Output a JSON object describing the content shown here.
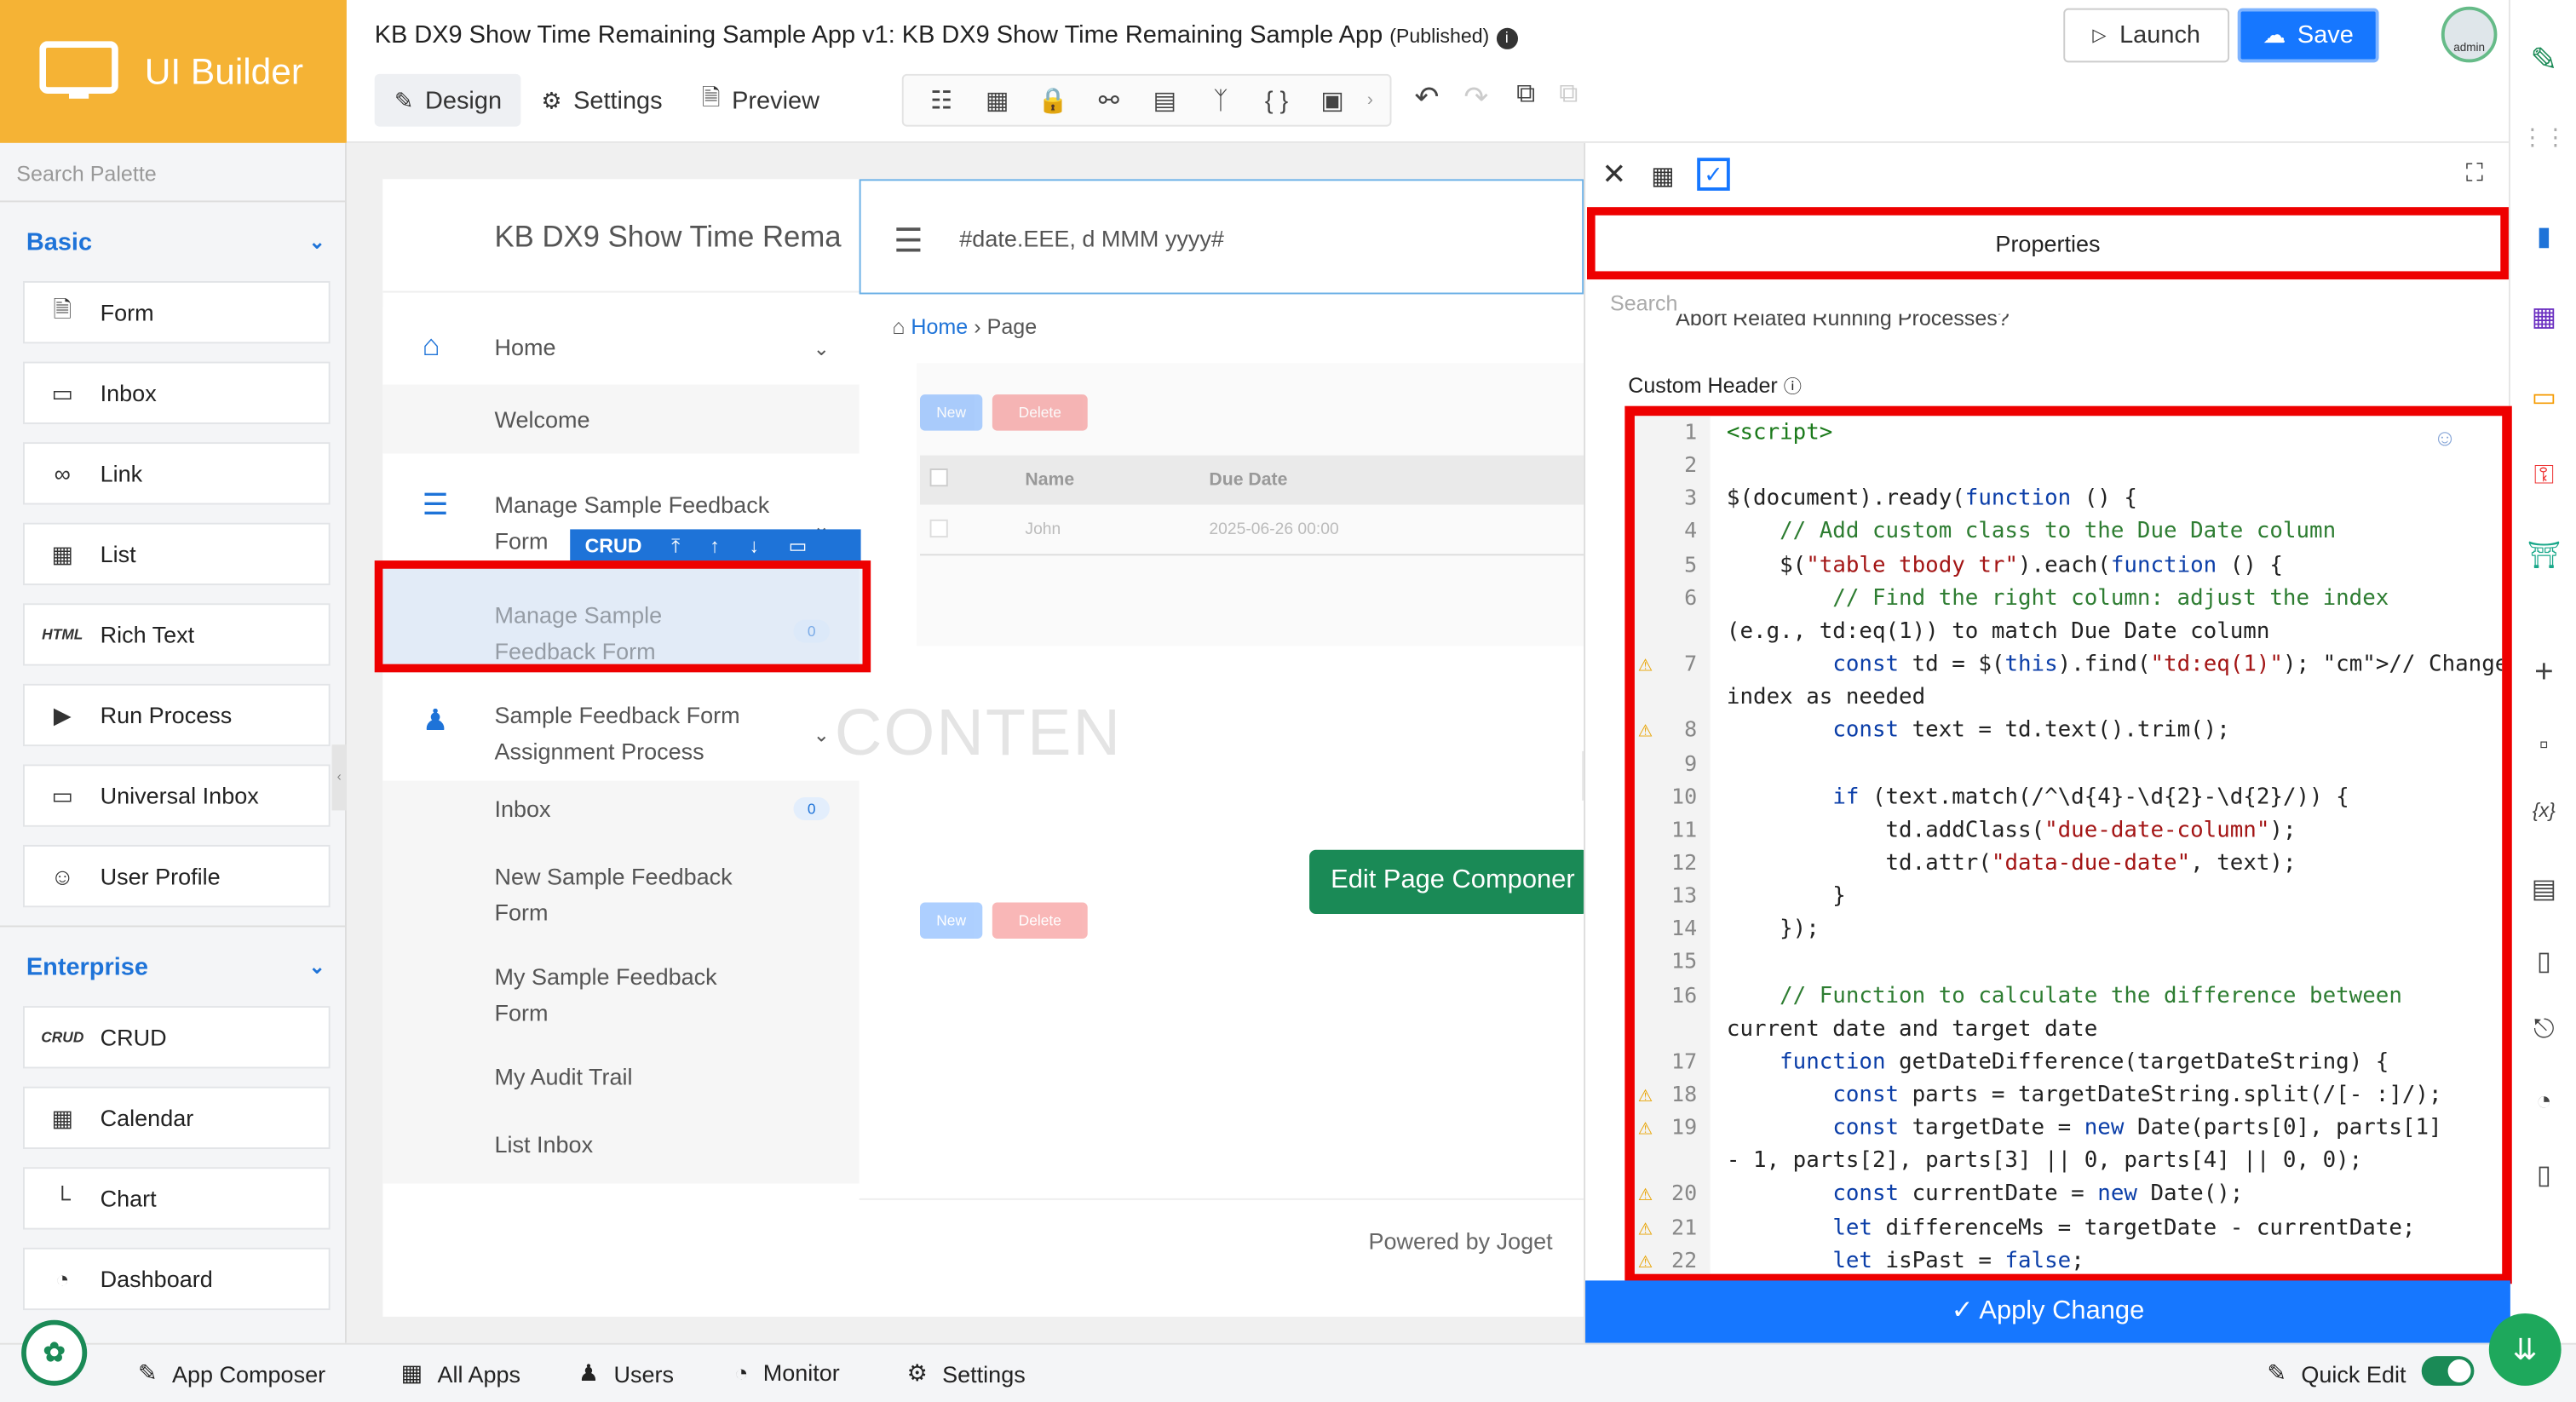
{
  "app": {
    "logo_text": "UI Builder",
    "title": "KB DX9 Show Time Remaining Sample App v1: KB DX9 Show Time Remaining Sample App",
    "status": "(Published)"
  },
  "tabs": [
    {
      "label": "Design"
    },
    {
      "label": "Settings"
    },
    {
      "label": "Preview"
    }
  ],
  "actions": {
    "launch": "Launch",
    "save": "Save",
    "avatar": "admin"
  },
  "palette": {
    "search_placeholder": "Search Palette",
    "basic_label": "Basic",
    "basic_items": [
      {
        "icon": "form-icon",
        "label": "Form"
      },
      {
        "icon": "inbox-icon",
        "label": "Inbox"
      },
      {
        "icon": "link-icon",
        "label": "Link"
      },
      {
        "icon": "list-icon",
        "label": "List"
      },
      {
        "icon": "html-icon",
        "icon_text": "HTML",
        "label": "Rich Text"
      },
      {
        "icon": "play-icon",
        "label": "Run Process"
      },
      {
        "icon": "inbox-icon",
        "label": "Universal Inbox"
      },
      {
        "icon": "user-icon",
        "label": "User Profile"
      }
    ],
    "enterprise_label": "Enterprise",
    "enterprise_items": [
      {
        "icon": "crud-icon",
        "icon_text": "CRUD",
        "label": "CRUD"
      },
      {
        "icon": "calendar-icon",
        "label": "Calendar"
      },
      {
        "icon": "chart-icon",
        "label": "Chart"
      },
      {
        "icon": "dashboard-icon",
        "label": "Dashboard"
      }
    ]
  },
  "canvas": {
    "brand": "KB DX9 Show Time Rema",
    "date_format": "#date.EEE, d MMM yyyy#",
    "menu": [
      {
        "label": "Home",
        "type": "category"
      },
      {
        "label": "Welcome"
      },
      {
        "label": "Manage Sample Feedback Form",
        "type": "category"
      },
      {
        "label": "Manage Sample Feedback Form",
        "badge": "0"
      },
      {
        "label": "Sample Feedback Form Assignment Process",
        "type": "category"
      },
      {
        "label": "Inbox",
        "badge": "0"
      },
      {
        "label": "New Sample Feedback Form"
      },
      {
        "label": "My Sample Feedback Form"
      },
      {
        "label": "My Audit Trail"
      },
      {
        "label": "List Inbox"
      }
    ],
    "crud_label": "CRUD",
    "breadcrumb": {
      "home": "Home",
      "page": "Page"
    },
    "list": {
      "new": "New",
      "delete": "Delete",
      "columns": [
        "Name",
        "Due Date"
      ],
      "rows": [
        [
          "John",
          "2025-06-26 00:00"
        ]
      ]
    },
    "content_placeholder": "CONTEN",
    "edit_button": "Edit Page Componer",
    "powered_by": "Powered by Joget"
  },
  "properties": {
    "title": "Properties",
    "search_placeholder": "Search",
    "prev_field": "Abort Related Running Processes?",
    "field_label": "Custom Header",
    "apply": "Apply Change",
    "code_lines": [
      {
        "n": "1",
        "text": "<script>"
      },
      {
        "n": "2",
        "text": ""
      },
      {
        "n": "3",
        "text": "$(document).ready(function () {"
      },
      {
        "n": "4",
        "text": "    // Add custom class to the Due Date column"
      },
      {
        "n": "5",
        "text": "    $(\"table tbody tr\").each(function () {"
      },
      {
        "n": "6",
        "text": "        // Find the right column: adjust the index"
      },
      {
        "n": "",
        "text": "(e.g., td:eq(1)) to match Due Date column"
      },
      {
        "n": "7",
        "warn": true,
        "text": "        const td = $(this).find(\"td:eq(1)\"); // Change"
      },
      {
        "n": "",
        "text": "index as needed"
      },
      {
        "n": "8",
        "warn": true,
        "text": "        const text = td.text().trim();"
      },
      {
        "n": "9",
        "text": ""
      },
      {
        "n": "10",
        "text": "        if (text.match(/^\\d{4}-\\d{2}-\\d{2}/)) {"
      },
      {
        "n": "11",
        "text": "            td.addClass(\"due-date-column\");"
      },
      {
        "n": "12",
        "text": "            td.attr(\"data-due-date\", text);"
      },
      {
        "n": "13",
        "text": "        }"
      },
      {
        "n": "14",
        "text": "    });"
      },
      {
        "n": "15",
        "text": ""
      },
      {
        "n": "16",
        "text": "    // Function to calculate the difference between"
      },
      {
        "n": "",
        "text": "current date and target date"
      },
      {
        "n": "17",
        "text": "    function getDateDifference(targetDateString) {"
      },
      {
        "n": "18",
        "warn": true,
        "text": "        const parts = targetDateString.split(/[- :]/);"
      },
      {
        "n": "19",
        "warn": true,
        "text": "        const targetDate = new Date(parts[0], parts[1]"
      },
      {
        "n": "",
        "text": "- 1, parts[2], parts[3] || 0, parts[4] || 0, 0);"
      },
      {
        "n": "20",
        "warn": true,
        "text": "        const currentDate = new Date();"
      },
      {
        "n": "21",
        "warn": true,
        "text": "        let differenceMs = targetDate - currentDate;"
      },
      {
        "n": "22",
        "warn": true,
        "text": "        let isPast = false;"
      }
    ]
  },
  "bottombar": [
    {
      "icon": "edit-icon",
      "label": "App Composer"
    },
    {
      "icon": "grid-icon",
      "label": "All Apps"
    },
    {
      "icon": "users-icon",
      "label": "Users"
    },
    {
      "icon": "monitor-icon",
      "label": "Monitor"
    },
    {
      "icon": "gears-icon",
      "label": "Settings"
    }
  ],
  "quick_edit": "Quick Edit",
  "colors": {
    "accent": "#1677ff",
    "logo_bg": "#f5b335",
    "highlight": "#ee0000",
    "joget_green": "#1a8a56"
  }
}
